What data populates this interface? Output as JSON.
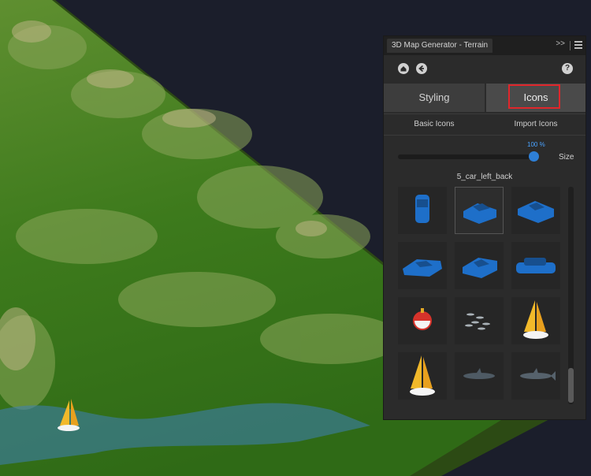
{
  "colors": {
    "accent": "#2e7fd6",
    "highlight": "#e0262b",
    "terrain_green": "#3f7a1e",
    "water": "#3e7fb8",
    "panel_bg": "#2b2b2b"
  },
  "panel": {
    "title": "3D Map Generator - Terrain",
    "collapse_icon": ">>",
    "help_icon": "?",
    "tabs": [
      {
        "label": "Styling"
      },
      {
        "label": "Icons"
      }
    ],
    "subtabs": [
      {
        "label": "Basic Icons"
      },
      {
        "label": "Import Icons"
      }
    ],
    "slider": {
      "percent_label": "100 %",
      "value_fraction": 1.0,
      "label": "Size"
    },
    "selected_icon": "5_car_left_back",
    "icons": [
      "car-front-icon",
      "car-left-back-icon",
      "car-right-icon",
      "car-left-icon",
      "car-left-back-2-icon",
      "car-right-2-icon",
      "buoy-icon",
      "fish-school-icon",
      "sailboat-icon",
      "sailboat-2-icon",
      "shark-icon",
      "shark-2-icon"
    ]
  }
}
